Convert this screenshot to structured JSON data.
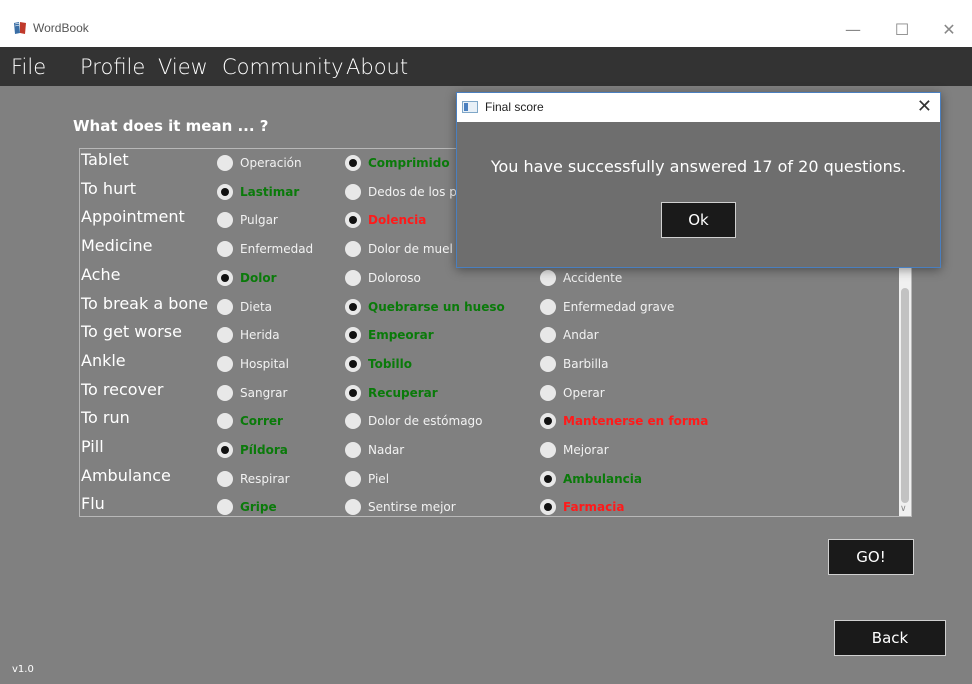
{
  "window": {
    "title": "WordBook",
    "minimize": "—",
    "maximize": "☐",
    "close": "✕"
  },
  "menu": {
    "items": [
      "File",
      "Profile",
      "View",
      "Community",
      "About"
    ]
  },
  "quiz": {
    "prompt": "What does it mean ... ?",
    "rows": [
      {
        "word": "Tablet",
        "options": [
          {
            "label": "Operación",
            "selected": false,
            "state": "normal"
          },
          {
            "label": "Comprimido",
            "selected": true,
            "state": "correct"
          },
          {
            "label": "",
            "selected": false,
            "state": "normal"
          }
        ]
      },
      {
        "word": "To hurt",
        "options": [
          {
            "label": "Lastimar",
            "selected": true,
            "state": "correct"
          },
          {
            "label": "Dedos de los p",
            "selected": false,
            "state": "normal"
          },
          {
            "label": "",
            "selected": false,
            "state": "normal"
          }
        ]
      },
      {
        "word": "Appointment",
        "options": [
          {
            "label": "Pulgar",
            "selected": false,
            "state": "normal"
          },
          {
            "label": "Dolencia",
            "selected": true,
            "state": "wrong"
          },
          {
            "label": "",
            "selected": false,
            "state": "normal"
          }
        ]
      },
      {
        "word": "Medicine",
        "options": [
          {
            "label": "Enfermedad",
            "selected": false,
            "state": "normal"
          },
          {
            "label": "Dolor de muel",
            "selected": false,
            "state": "normal"
          },
          {
            "label": "",
            "selected": false,
            "state": "normal"
          }
        ]
      },
      {
        "word": "Ache",
        "options": [
          {
            "label": "Dolor",
            "selected": true,
            "state": "correct"
          },
          {
            "label": "Doloroso",
            "selected": false,
            "state": "normal"
          },
          {
            "label": "Accidente",
            "selected": false,
            "state": "normal"
          }
        ]
      },
      {
        "word": "To break a bone",
        "options": [
          {
            "label": "Dieta",
            "selected": false,
            "state": "normal"
          },
          {
            "label": "Quebrarse un hueso",
            "selected": true,
            "state": "correct"
          },
          {
            "label": "Enfermedad grave",
            "selected": false,
            "state": "normal"
          }
        ]
      },
      {
        "word": "To get worse",
        "options": [
          {
            "label": "Herida",
            "selected": false,
            "state": "normal"
          },
          {
            "label": "Empeorar",
            "selected": true,
            "state": "correct"
          },
          {
            "label": "Andar",
            "selected": false,
            "state": "normal"
          }
        ]
      },
      {
        "word": "Ankle",
        "options": [
          {
            "label": "Hospital",
            "selected": false,
            "state": "normal"
          },
          {
            "label": "Tobillo",
            "selected": true,
            "state": "correct"
          },
          {
            "label": "Barbilla",
            "selected": false,
            "state": "normal"
          }
        ]
      },
      {
        "word": "To recover",
        "options": [
          {
            "label": "Sangrar",
            "selected": false,
            "state": "normal"
          },
          {
            "label": "Recuperar",
            "selected": true,
            "state": "correct"
          },
          {
            "label": "Operar",
            "selected": false,
            "state": "normal"
          }
        ]
      },
      {
        "word": "To run",
        "options": [
          {
            "label": "Correr",
            "selected": false,
            "state": "correct"
          },
          {
            "label": "Dolor de estómago",
            "selected": false,
            "state": "normal"
          },
          {
            "label": "Mantenerse en forma",
            "selected": true,
            "state": "wrong"
          }
        ]
      },
      {
        "word": "Pill",
        "options": [
          {
            "label": "Píldora",
            "selected": true,
            "state": "correct"
          },
          {
            "label": "Nadar",
            "selected": false,
            "state": "normal"
          },
          {
            "label": "Mejorar",
            "selected": false,
            "state": "normal"
          }
        ]
      },
      {
        "word": "Ambulance",
        "options": [
          {
            "label": "Respirar",
            "selected": false,
            "state": "normal"
          },
          {
            "label": "Piel",
            "selected": false,
            "state": "normal"
          },
          {
            "label": "Ambulancia",
            "selected": true,
            "state": "correct"
          }
        ]
      },
      {
        "word": "Flu",
        "options": [
          {
            "label": "Gripe",
            "selected": false,
            "state": "correct"
          },
          {
            "label": "Sentirse mejor",
            "selected": false,
            "state": "normal"
          },
          {
            "label": "Farmacia",
            "selected": true,
            "state": "wrong"
          }
        ]
      }
    ]
  },
  "buttons": {
    "go": "GO!",
    "back": "Back"
  },
  "version": "v1.0",
  "dialog": {
    "title": "Final score",
    "close": "✕",
    "message": "You have successfully answered 17 of 20 questions.",
    "ok": "Ok"
  },
  "colors": {
    "correct": "#0a7a0a",
    "wrong": "#ff1a1a",
    "background": "#808080",
    "menubar": "#333333"
  }
}
